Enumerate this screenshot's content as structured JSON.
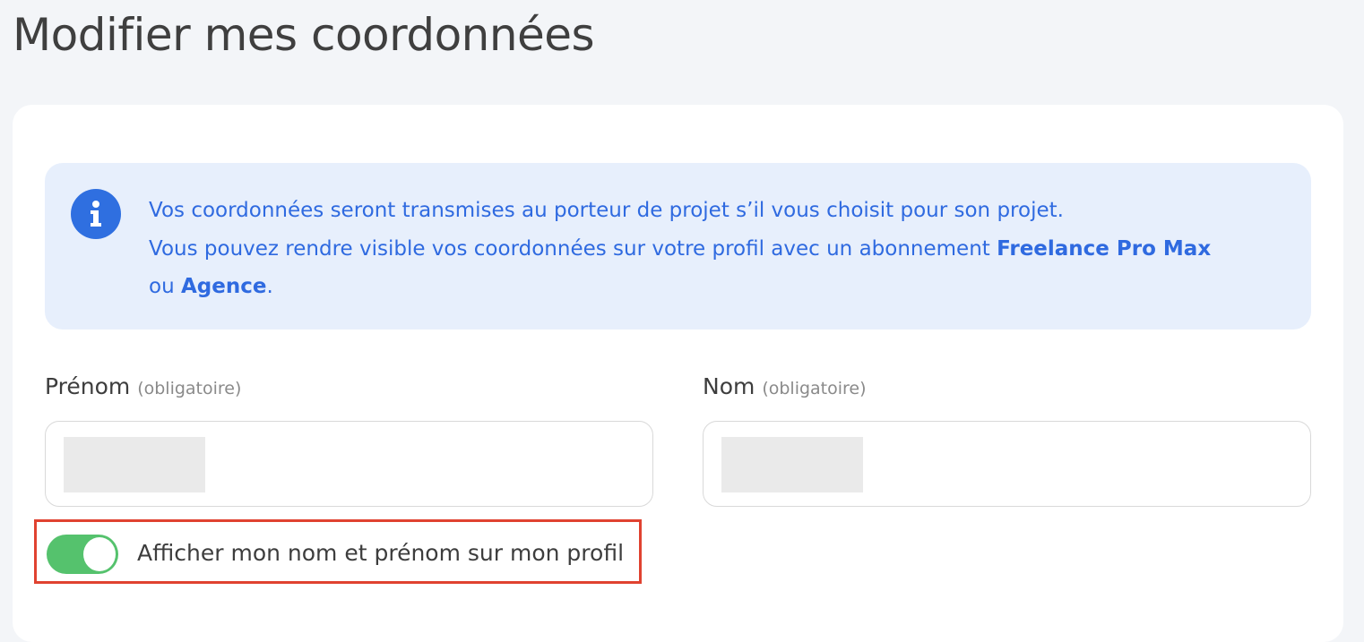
{
  "page": {
    "title": "Modifier mes coordonnées"
  },
  "info": {
    "icon": "info-icon",
    "line1": "Vos coordonnées seront transmises au porteur de projet s’il vous choisit pour son projet.",
    "line2_prefix": "Vous pouvez rendre visible vos coordonnées sur votre profil avec un abonnement ",
    "plan_pro_max": "Freelance Pro Max",
    "line3_prefix": "ou ",
    "plan_agence": "Agence",
    "line3_suffix": "."
  },
  "form": {
    "first_name": {
      "label": "Prénom",
      "required_note": "(obligatoire)",
      "value": ""
    },
    "last_name": {
      "label": "Nom",
      "required_note": "(obligatoire)",
      "value": ""
    },
    "show_name_toggle": {
      "label": "Afficher mon nom et prénom sur mon profil",
      "checked": true
    }
  },
  "colors": {
    "accent": "#2f6fe0",
    "toggle_on": "#55c26d",
    "highlight": "#e04230"
  }
}
